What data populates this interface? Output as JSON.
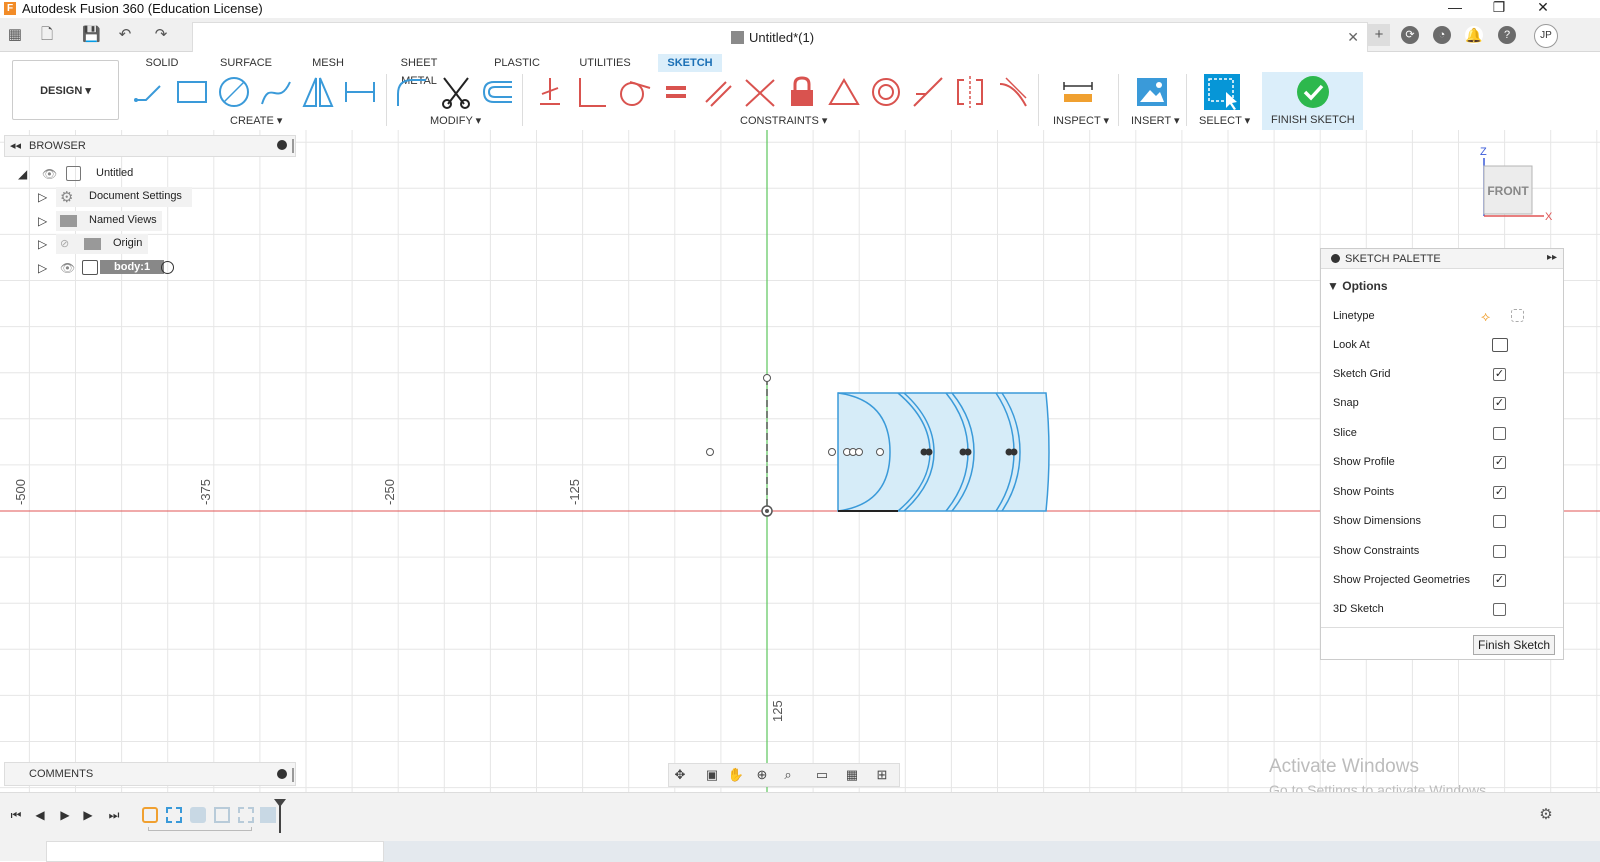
{
  "window": {
    "title": "Autodesk Fusion 360 (Education License)",
    "app_icon": "F",
    "controls": [
      "—",
      "❐",
      "✕"
    ]
  },
  "document": {
    "tab_title": "Untitled*(1)",
    "user_initials": "JP"
  },
  "ribbon": {
    "tabs": [
      "SOLID",
      "SURFACE",
      "MESH",
      "SHEET METAL",
      "PLASTIC",
      "UTILITIES",
      "SKETCH"
    ],
    "active_tab": "SKETCH",
    "workspace": "DESIGN ▾",
    "groups": {
      "create": "CREATE ▾",
      "modify": "MODIFY ▾",
      "constraints": "CONSTRAINTS ▾",
      "inspect": "INSPECT ▾",
      "insert": "INSERT ▾",
      "select": "SELECT ▾",
      "finish": "FINISH SKETCH ▾"
    }
  },
  "browser": {
    "title": "BROWSER",
    "items": [
      {
        "label": "Untitled",
        "icon": "component-icon"
      },
      {
        "label": "Document Settings",
        "icon": "gear-icon"
      },
      {
        "label": "Named Views",
        "icon": "folder-icon"
      },
      {
        "label": "Origin",
        "icon": "folder-icon"
      },
      {
        "label": "body:1",
        "icon": "body-icon"
      }
    ]
  },
  "comments": {
    "title": "COMMENTS"
  },
  "viewcube": {
    "face": "FRONT",
    "axis_z": "Z",
    "axis_x": "X"
  },
  "canvas": {
    "ruler_labels": [
      "-500",
      "-375",
      "-250",
      "-125",
      "125"
    ],
    "grid_color": "#e6e6e6",
    "x_axis_color": "#e05555",
    "z_axis_color": "#5cc65c",
    "sketch_color": "#3a9ad9",
    "profile_fill": "#d6ecf8"
  },
  "sketch_palette": {
    "title": "SKETCH PALETTE",
    "section": "Options",
    "rows": [
      {
        "label": "Linetype",
        "type": "icons"
      },
      {
        "label": "Look At",
        "type": "icon"
      },
      {
        "label": "Sketch Grid",
        "checked": true
      },
      {
        "label": "Snap",
        "checked": true
      },
      {
        "label": "Slice",
        "checked": false
      },
      {
        "label": "Show Profile",
        "checked": true
      },
      {
        "label": "Show Points",
        "checked": true
      },
      {
        "label": "Show Dimensions",
        "checked": false
      },
      {
        "label": "Show Constraints",
        "checked": false
      },
      {
        "label": "Show Projected Geometries",
        "checked": true
      },
      {
        "label": "3D Sketch",
        "checked": false
      }
    ],
    "finish_button": "Finish Sketch"
  },
  "watermark": {
    "line1": "Activate Windows",
    "line2": "Go to Settings to activate Windows."
  },
  "colors": {
    "accent": "#0696d7",
    "finish_green": "#2db84d",
    "constraint_red": "#d9534f"
  }
}
